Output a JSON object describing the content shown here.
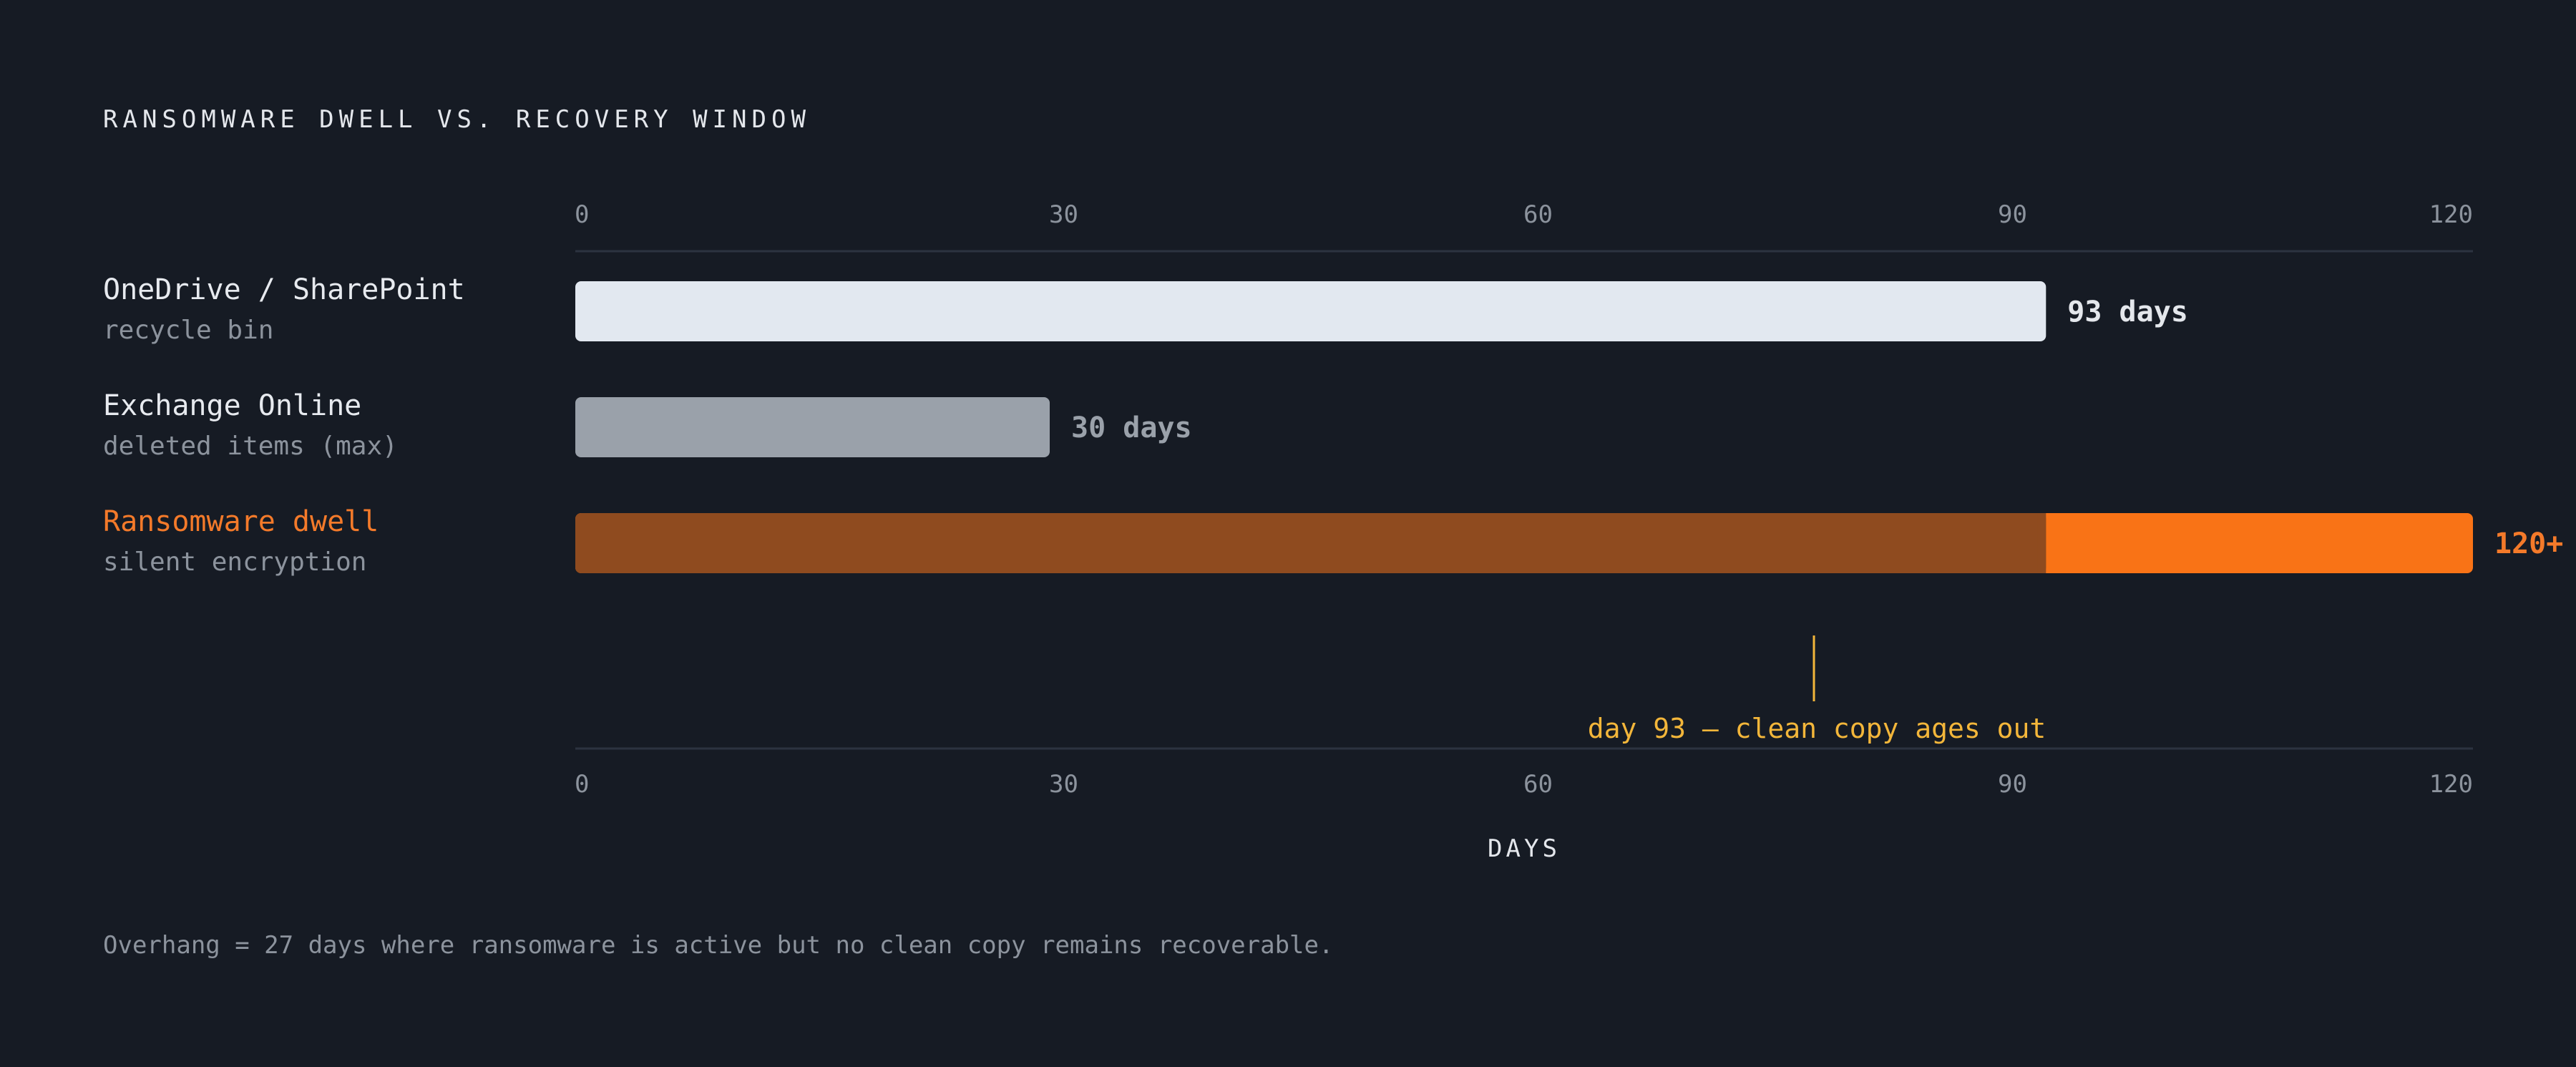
{
  "colors": {
    "background": "#161b24",
    "grid": "#2c3340",
    "bar_onedrive": "#e2e8f0",
    "bar_exchange": "#9aa1aa",
    "bar_dwell_covered": "#8f4b1f",
    "bar_dwell_overhang": "#f97316",
    "label_onedrive": "#e4e7ec",
    "label_exchange": "#9aa1aa",
    "label_dwell": "#f47a2a",
    "annotation": "#f3b63a"
  },
  "chart_data": {
    "type": "bar",
    "orientation": "horizontal",
    "title": "RANSOMWARE DWELL VS. RECOVERY WINDOW",
    "xlabel": "DAYS",
    "xlim": [
      0,
      120
    ],
    "ticks": [
      "0",
      "30",
      "60",
      "90",
      "120"
    ],
    "tick_values": [
      0,
      30,
      60,
      90,
      120
    ],
    "grid": false,
    "categories": [
      {
        "label": "OneDrive / SharePoint",
        "sublabel": "recycle bin",
        "value": 93,
        "value_label": "93 days"
      },
      {
        "label": "Exchange Online",
        "sublabel": "deleted items (max)",
        "value": 30,
        "value_label": "30 days"
      },
      {
        "label": "Ransomware dwell",
        "sublabel": "silent encryption",
        "value": 120,
        "segments": [
          {
            "from": 0,
            "to": 93
          },
          {
            "from": 93,
            "to": 120
          }
        ],
        "value_label": "120+"
      }
    ],
    "annotation": {
      "x": 93,
      "text": "day 93 — clean copy ages out"
    }
  },
  "footnote": "Overhang = 27 days where ransomware is active but no clean copy remains recoverable."
}
